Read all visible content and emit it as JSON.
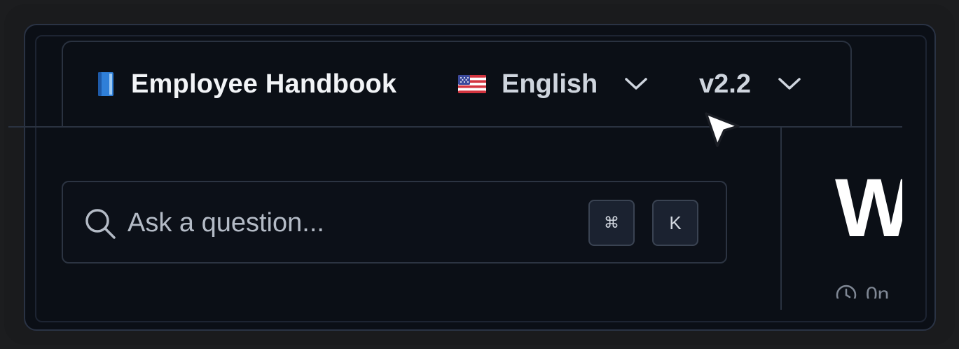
{
  "header": {
    "title": "Employee Handbook",
    "language": "English",
    "version": "v2.2"
  },
  "search": {
    "placeholder": "Ask a question...",
    "shortcut_modifier": "⌘",
    "shortcut_key": "K"
  },
  "content": {
    "heading_partial": "W",
    "meta_partial": "0n"
  },
  "icons": {
    "title_icon": "blue-book-icon",
    "language_icon": "us-flag-icon",
    "language_dropdown": "chevron-down-icon",
    "version_dropdown": "chevron-down-icon",
    "search": "search-icon",
    "meta": "clock-icon",
    "pointer": "mouse-cursor-icon"
  },
  "colors": {
    "background": "#0b0f16",
    "border": "#2a3240",
    "title_text": "#f2f4f7",
    "secondary_text": "#cfd5de",
    "kbd_background": "#1b2230"
  }
}
